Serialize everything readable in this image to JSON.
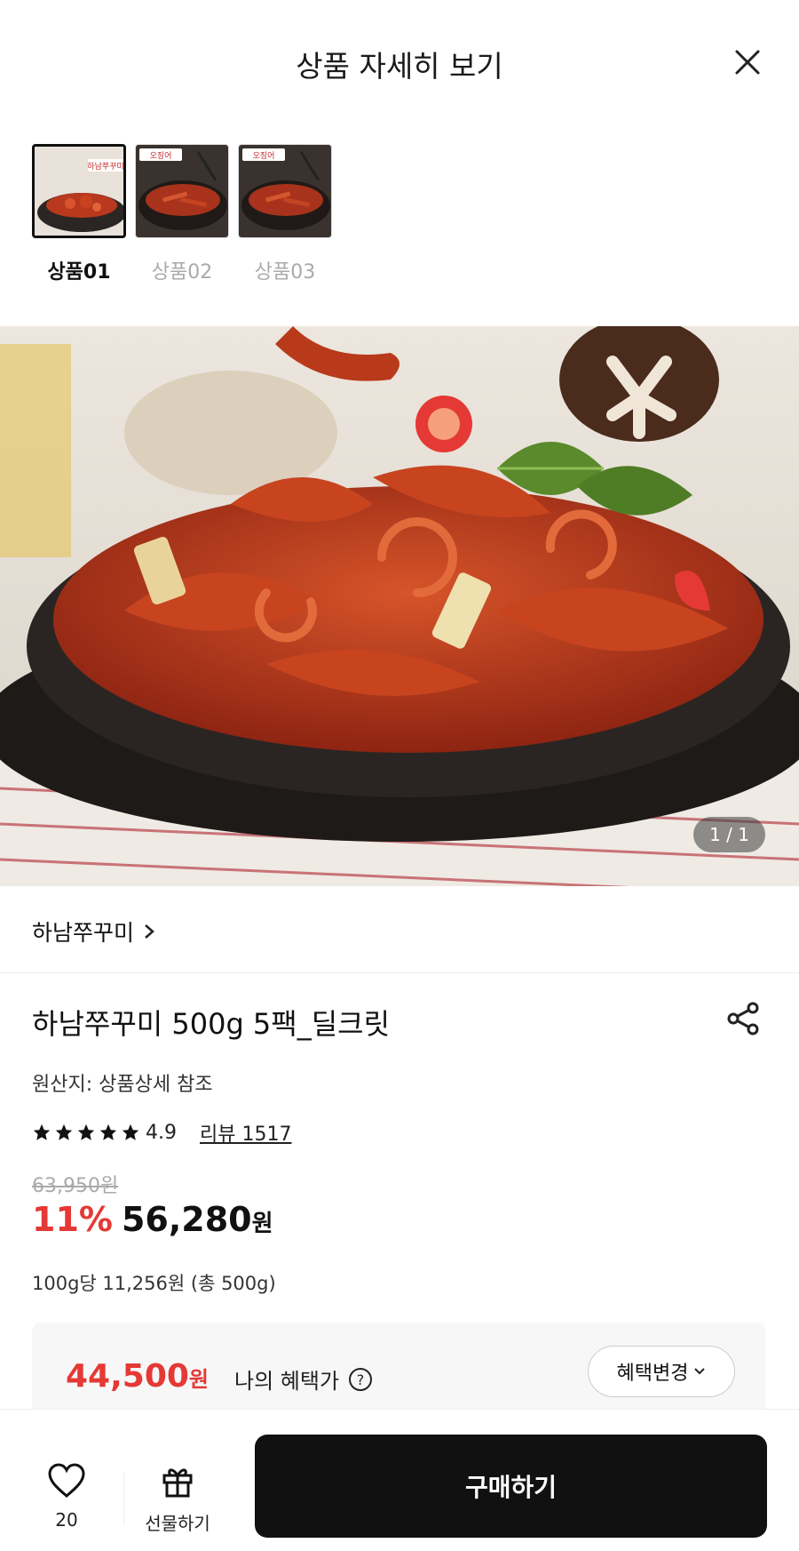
{
  "header": {
    "title": "상품 자세히 보기"
  },
  "thumbnails": [
    {
      "label": "상품01",
      "badge": "하남쭈꾸미"
    },
    {
      "label": "상품02",
      "badge": "오징어"
    },
    {
      "label": "상품03",
      "badge": "오징어"
    }
  ],
  "hero": {
    "pager": "1 / 1"
  },
  "brand": {
    "name": "하남쭈꾸미"
  },
  "product": {
    "title": "하남쭈꾸미 500g 5팩_딜크릿",
    "origin": "원산지: 상품상세 참조",
    "rating": "4.9",
    "rating_value": 4.9,
    "review": "리뷰 1517",
    "original_price": "63,950원",
    "discount": "11%",
    "sale_price": "56,280",
    "won": "원",
    "unit_price": "100g당 11,256원 (총 500g)"
  },
  "benefit": {
    "price": "44,500",
    "won": "원",
    "label": "나의 혜택가",
    "button": "혜택변경"
  },
  "bottom": {
    "like_count": "20",
    "gift_label": "선물하기",
    "buy_label": "구매하기"
  },
  "colors": {
    "accent_red": "#e53935",
    "dark": "#111111"
  }
}
